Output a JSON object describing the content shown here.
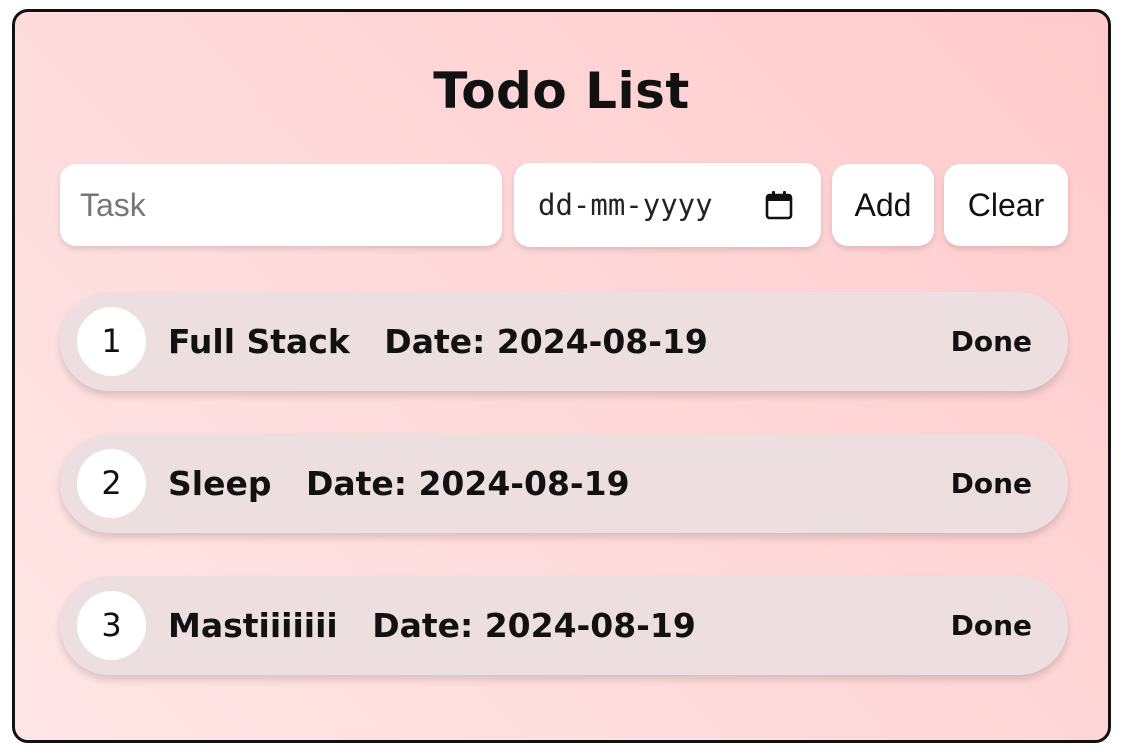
{
  "app": {
    "title": "Todo List"
  },
  "form": {
    "task_placeholder": "Task",
    "task_value": "",
    "date_placeholder": "dd-mm-yyyy",
    "add_label": "Add",
    "clear_label": "Clear"
  },
  "todos": [
    {
      "index": "1",
      "task": "Full Stack",
      "date_label": "Date: 2024-08-19",
      "done_label": "Done"
    },
    {
      "index": "2",
      "task": "Sleep",
      "date_label": "Date: 2024-08-19",
      "done_label": "Done"
    },
    {
      "index": "3",
      "task": "Mastiiiiiii",
      "date_label": "Date: 2024-08-19",
      "done_label": "Done"
    }
  ],
  "colors": {
    "background_start": "#ffe6e6",
    "background_end": "#ffcacb",
    "item_background": "#eddfe0",
    "border": "#111111"
  },
  "icons": {
    "date_picker": "calendar-icon"
  }
}
